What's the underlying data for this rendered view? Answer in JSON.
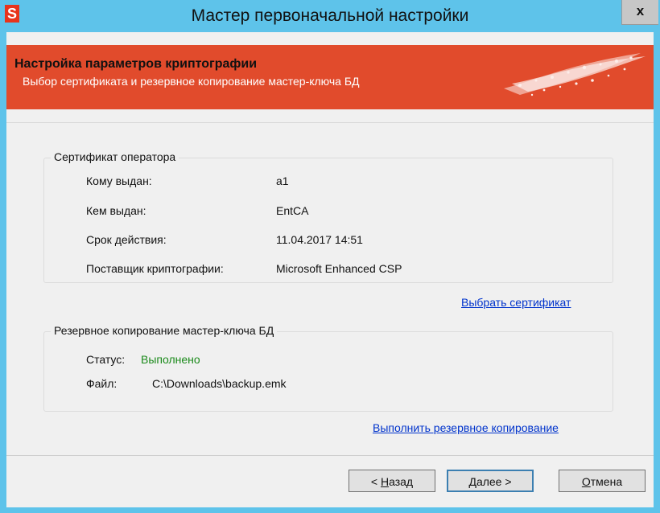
{
  "window": {
    "app_icon_letter": "S",
    "title": "Мастер первоначальной настройки",
    "close_label": "x"
  },
  "banner": {
    "title": "Настройка параметров криптографии",
    "subtitle": "Выбор сертификата и резервное копирование мастер-ключа БД"
  },
  "certificate": {
    "group_title": "Сертификат оператора",
    "rows": [
      {
        "label": "Кому выдан:",
        "value": "a1"
      },
      {
        "label": "Кем выдан:",
        "value": "EntCA"
      },
      {
        "label": "Срок действия:",
        "value": "11.04.2017 14:51"
      },
      {
        "label": "Поставщик криптографии:",
        "value": "Microsoft Enhanced CSP"
      }
    ],
    "select_link": "Выбрать сертификат"
  },
  "backup": {
    "group_title": "Резервное копирование мастер-ключа БД",
    "status_label": "Статус:",
    "status_value": "Выполнено",
    "file_label": "Файл:",
    "file_value": "C:\\Downloads\\backup.emk",
    "run_link": "Выполнить резервное копирование"
  },
  "buttons": {
    "back_prefix": "< ",
    "back_key": "Н",
    "back_rest": "азад",
    "next_key": "Д",
    "next_rest": "алее >",
    "cancel_key": "О",
    "cancel_rest": "тмена"
  },
  "colors": {
    "titlebar": "#5ec3ea",
    "banner": "#e14b2c",
    "status_ok": "#1a8a1a",
    "link": "#0033cc"
  }
}
